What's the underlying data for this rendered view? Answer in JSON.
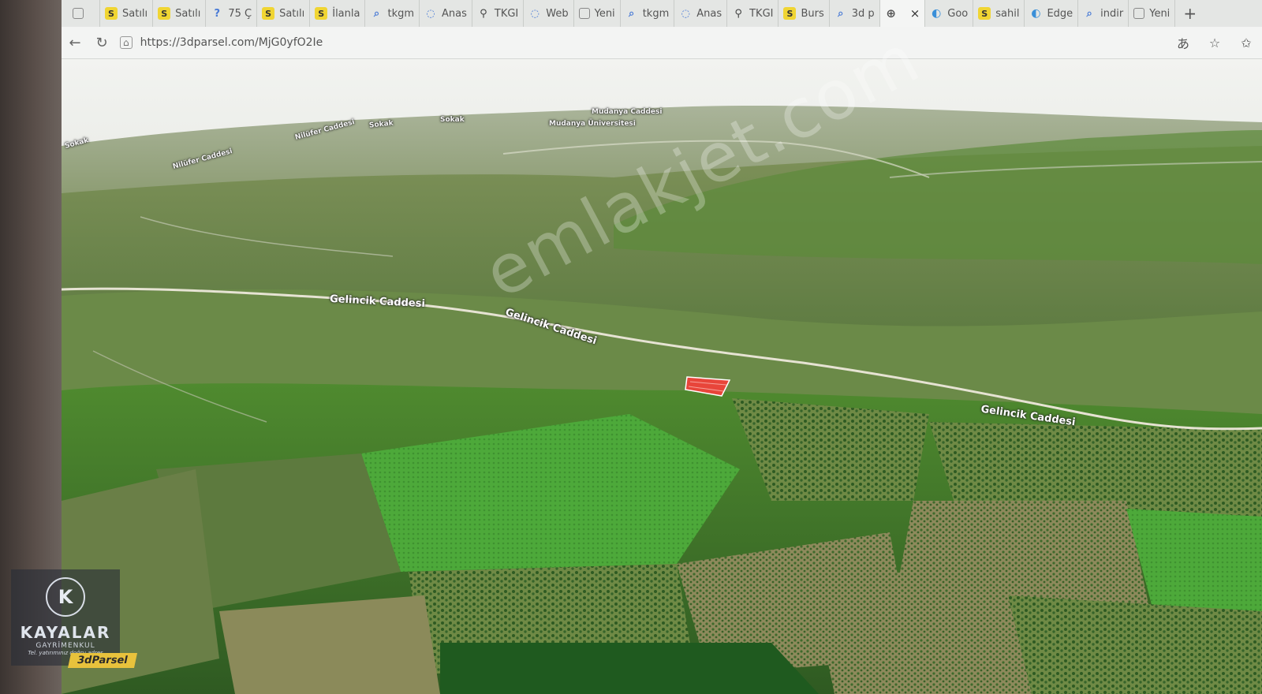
{
  "browser": {
    "tabs": [
      {
        "icon": "s-icon",
        "label": "Satılı",
        "active": false
      },
      {
        "icon": "s-icon",
        "label": "Satılı",
        "active": false
      },
      {
        "icon": "question-icon",
        "label": "75 Ç",
        "active": false
      },
      {
        "icon": "s-icon",
        "label": "Satılı",
        "active": false
      },
      {
        "icon": "s-icon",
        "label": "İlanla",
        "active": false
      },
      {
        "icon": "search-icon",
        "label": "tkgm",
        "active": false
      },
      {
        "icon": "loading-icon",
        "label": "Anas",
        "active": false
      },
      {
        "icon": "pin-icon",
        "label": "TKGI",
        "active": false
      },
      {
        "icon": "loading-icon",
        "label": "Web",
        "active": false
      },
      {
        "icon": "window-icon",
        "label": "Yeni",
        "active": false
      },
      {
        "icon": "search-icon",
        "label": "tkgm",
        "active": false
      },
      {
        "icon": "loading-icon",
        "label": "Anas",
        "active": false
      },
      {
        "icon": "pin-icon",
        "label": "TKGI",
        "active": false
      },
      {
        "icon": "s-icon",
        "label": "Burs",
        "active": false
      },
      {
        "icon": "search-icon",
        "label": "3d p",
        "active": false
      },
      {
        "icon": "globe-icon",
        "label": "",
        "active": true
      },
      {
        "icon": "edge-icon",
        "label": "Goo",
        "active": false
      },
      {
        "icon": "s-icon",
        "label": "sahil",
        "active": false
      },
      {
        "icon": "edge-icon",
        "label": "Edge",
        "active": false
      },
      {
        "icon": "search-icon",
        "label": "indir",
        "active": false
      },
      {
        "icon": "window-icon",
        "label": "Yeni",
        "active": false
      }
    ],
    "new_tab": "+",
    "close_glyph": "×",
    "url": "https://3dparsel.com/MjG0yfO2Ie"
  },
  "map": {
    "labels": [
      {
        "text": "Gelincik Caddesi",
        "size": "normal"
      },
      {
        "text": "Gelincik Caddesi",
        "size": "normal"
      },
      {
        "text": "Gelincik Caddesi",
        "size": "normal"
      },
      {
        "text": "Nilüfer Caddesi",
        "size": "small"
      },
      {
        "text": "Nilüfer Caddesi",
        "size": "small"
      },
      {
        "text": "Mudanya Caddesi",
        "size": "small"
      },
      {
        "text": "Mudanya Üniversitesi",
        "size": "small"
      },
      {
        "text": "Sokak",
        "size": "small"
      },
      {
        "text": "Sokak",
        "size": "small"
      },
      {
        "text": "Sokak",
        "size": "small"
      }
    ],
    "watermark": "emlakjet.com",
    "parcel_color": "#e8453a"
  },
  "logo": {
    "brand": "KAYALAR",
    "sub": "GAYRİMENKUL",
    "slogan": "Tel. yatırımınız doğru adres",
    "badge": "3dParsel"
  }
}
